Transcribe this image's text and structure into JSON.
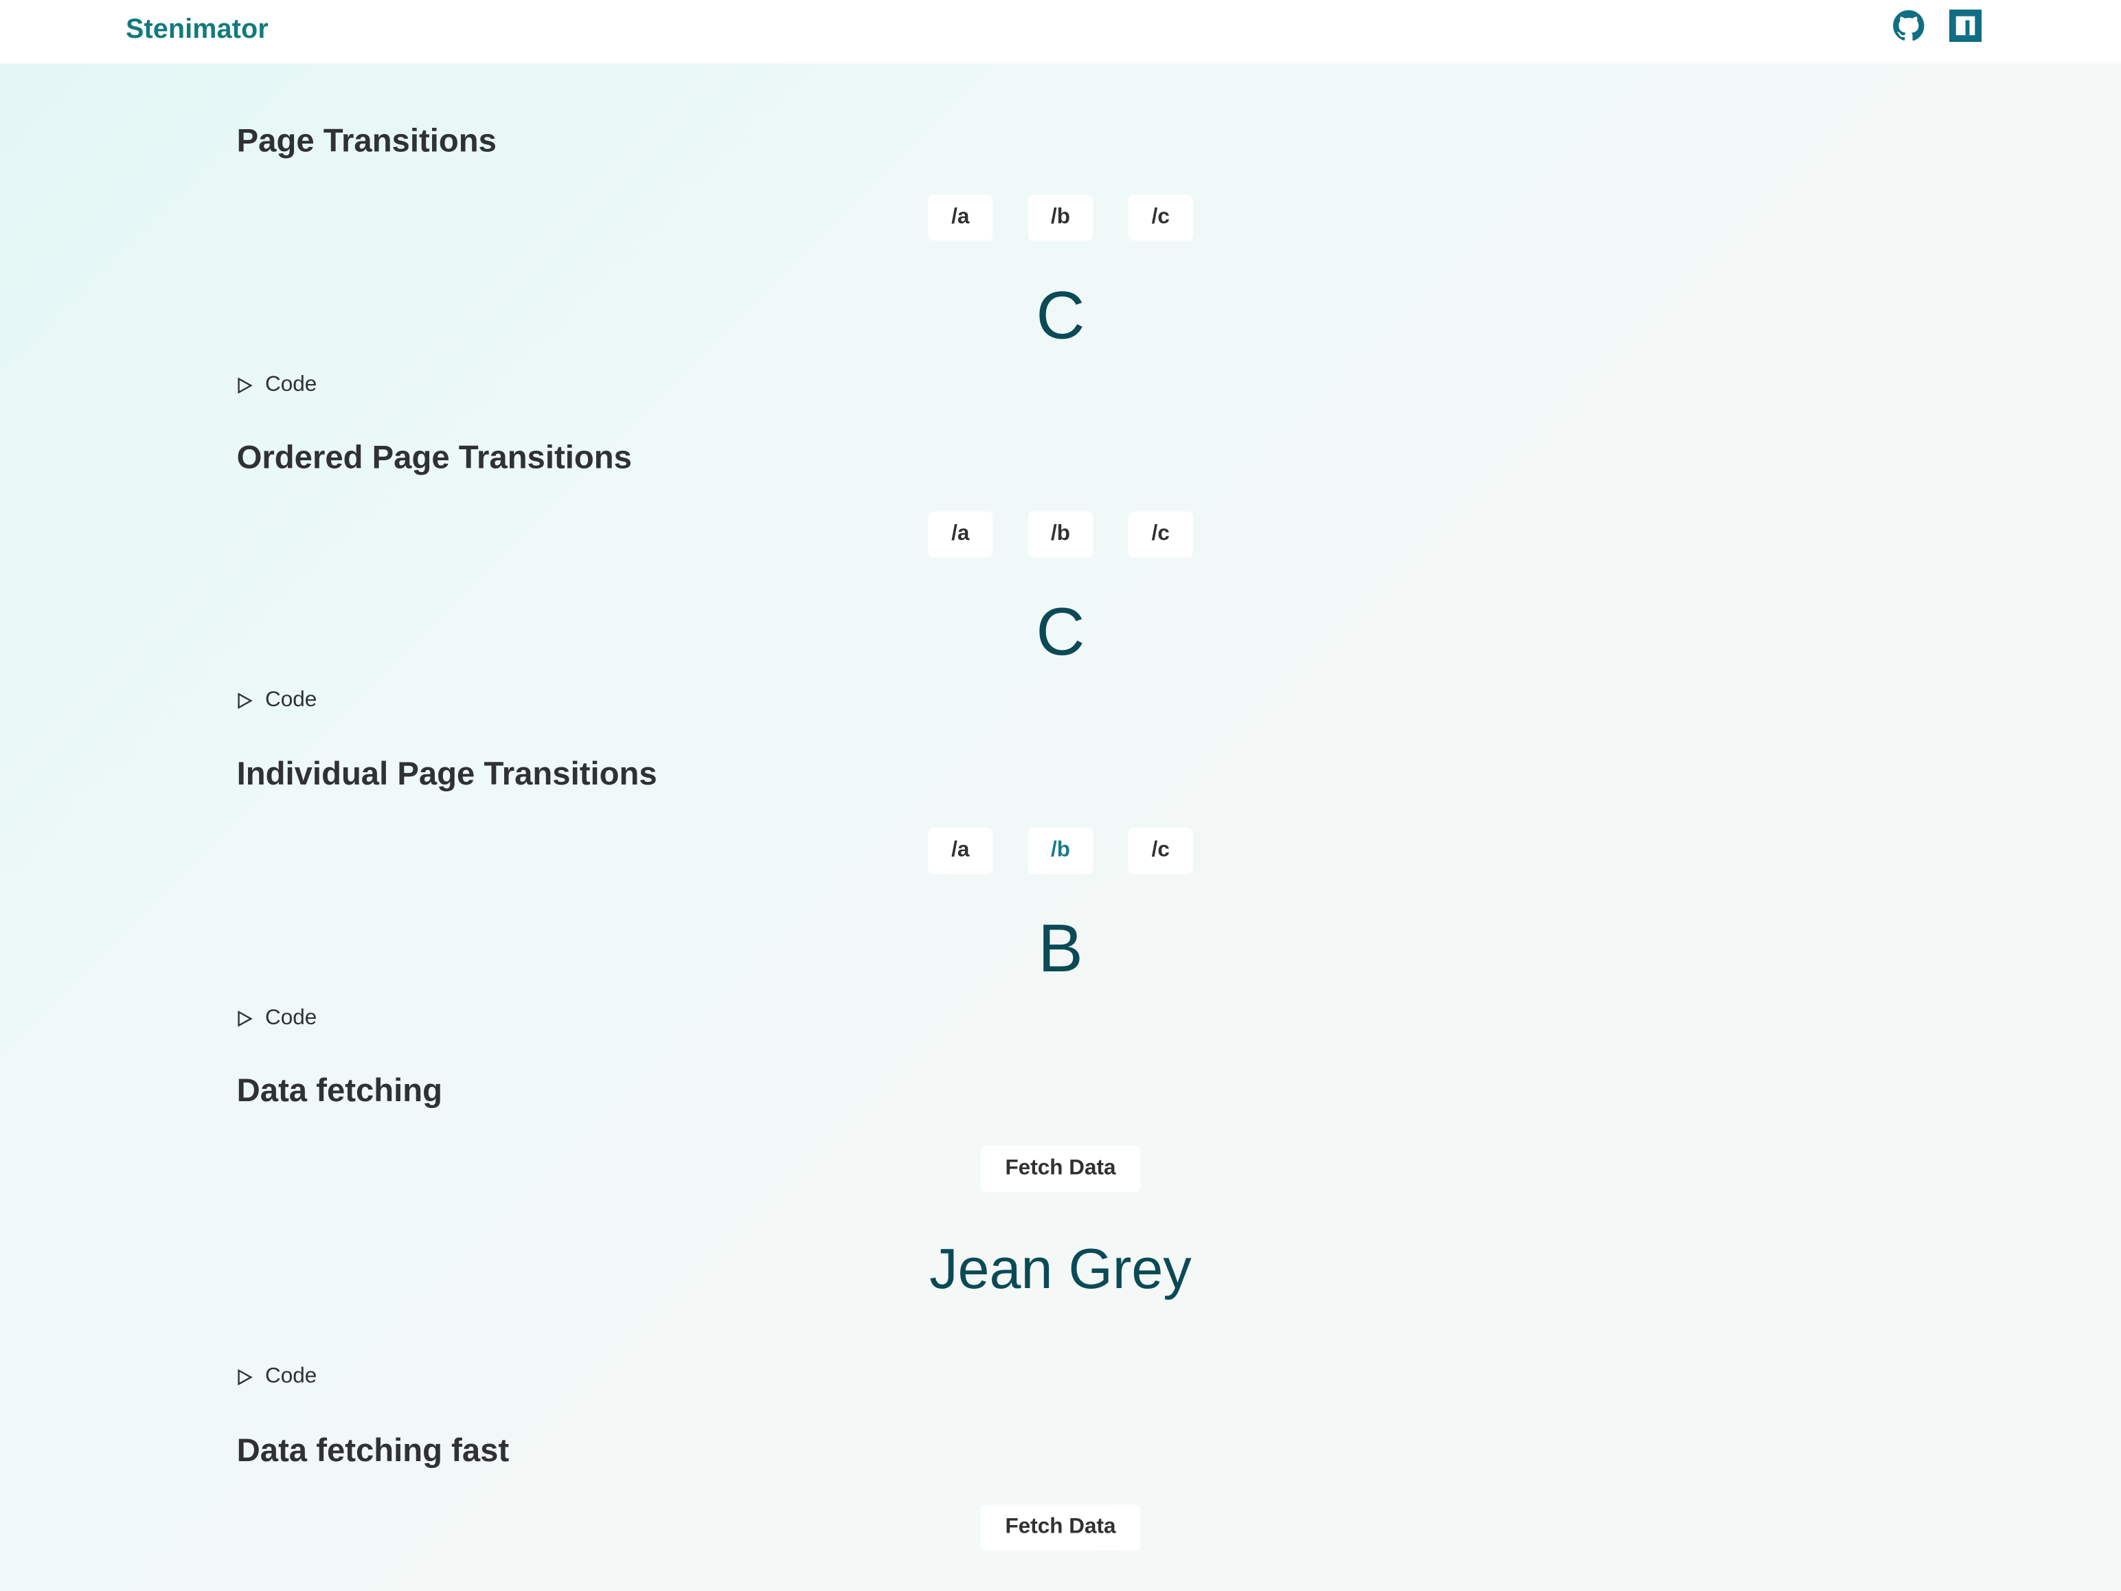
{
  "navbar": {
    "brand": "Stenimator",
    "icons": [
      "github-icon",
      "npm-icon"
    ],
    "accent_color": "#117a7c"
  },
  "sections": [
    {
      "title": "Page Transitions",
      "routes": [
        "/a",
        "/b",
        "/c"
      ],
      "active_route": null,
      "display": "C",
      "code_label": "Code"
    },
    {
      "title": "Ordered Page Transitions",
      "routes": [
        "/a",
        "/b",
        "/c"
      ],
      "active_route": null,
      "display": "C",
      "code_label": "Code"
    },
    {
      "title": "Individual Page Transitions",
      "routes": [
        "/a",
        "/b",
        "/c"
      ],
      "active_route": "/b",
      "display": "B",
      "code_label": "Code"
    },
    {
      "title": "Data fetching",
      "button": "Fetch Data",
      "display": "Jean Grey",
      "code_label": "Code"
    },
    {
      "title": "Data fetching fast",
      "button": "Fetch Data"
    }
  ],
  "colors": {
    "text": "#2f3133",
    "display_text": "#0a4a57",
    "active_route": "#1a7a8a"
  }
}
